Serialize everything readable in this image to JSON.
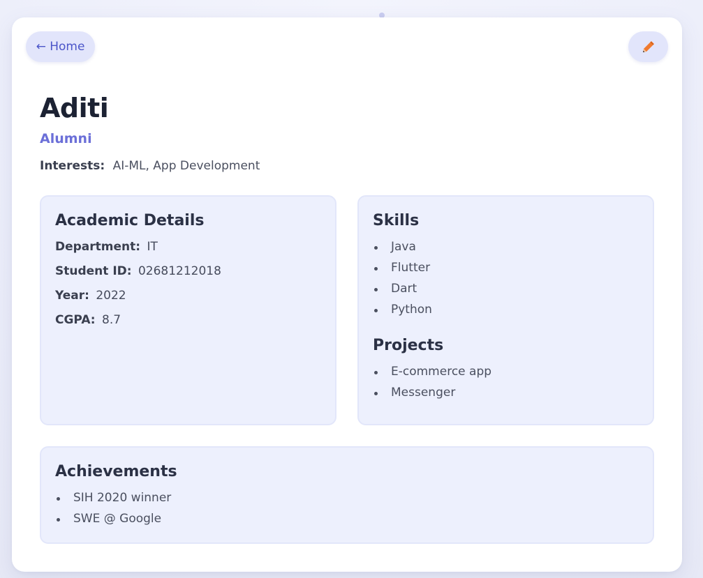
{
  "nav": {
    "home_label": "← Home",
    "edit_icon": "pencil-icon"
  },
  "profile": {
    "name": "Aditi",
    "role": "Alumni",
    "interests_label": "Interests:",
    "interests_value": "AI-ML, App Development"
  },
  "academic": {
    "title": "Academic Details",
    "fields": [
      {
        "label": "Department:",
        "value": "IT"
      },
      {
        "label": "Student ID:",
        "value": "02681212018"
      },
      {
        "label": "Year:",
        "value": "2022"
      },
      {
        "label": "CGPA:",
        "value": "8.7"
      }
    ]
  },
  "skills": {
    "title": "Skills",
    "items": [
      "Java",
      "Flutter",
      "Dart",
      "Python"
    ]
  },
  "projects": {
    "title": "Projects",
    "items": [
      "E-commerce app",
      "Messenger"
    ]
  },
  "achievements": {
    "title": "Achievements",
    "items": [
      "SIH 2020 winner",
      "SWE @ Google"
    ]
  },
  "colors": {
    "accent": "#4b55c9",
    "role": "#6b6fd8",
    "panel_bg": "#edf0fd",
    "pencil": "#f07a2f"
  }
}
